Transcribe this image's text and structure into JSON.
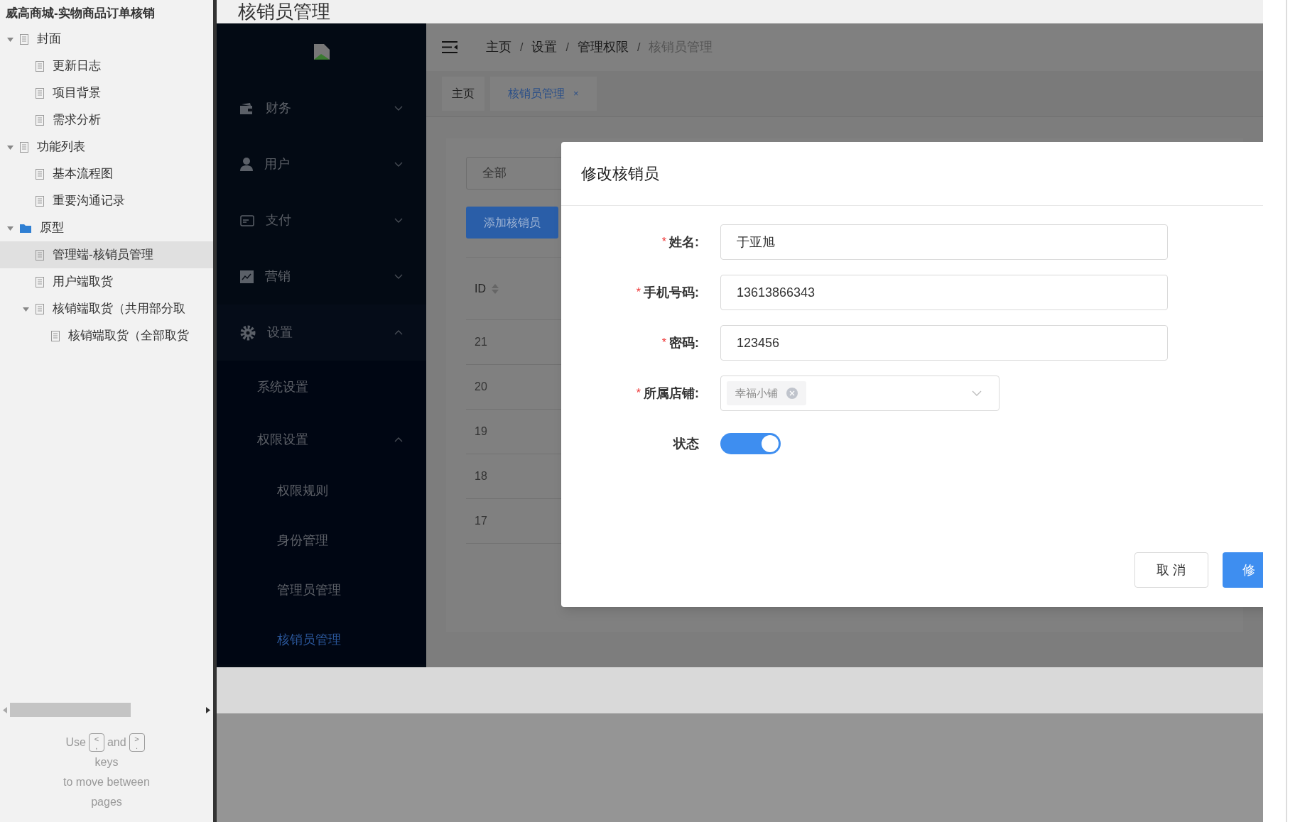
{
  "doc_panel": {
    "title": "威高商城-实物商品订单核销",
    "tree": [
      {
        "label": "封面",
        "kind": "page",
        "expanded": true,
        "selected": false,
        "children": [
          {
            "label": "更新日志",
            "kind": "page",
            "selected": false
          },
          {
            "label": "项目背景",
            "kind": "page",
            "selected": false
          },
          {
            "label": "需求分析",
            "kind": "page",
            "selected": false
          }
        ]
      },
      {
        "label": "功能列表",
        "kind": "page",
        "expanded": true,
        "selected": false,
        "children": [
          {
            "label": "基本流程图",
            "kind": "page",
            "selected": false
          },
          {
            "label": "重要沟通记录",
            "kind": "page",
            "selected": false
          }
        ]
      },
      {
        "label": "原型",
        "kind": "folder",
        "expanded": true,
        "selected": false,
        "children": [
          {
            "label": "管理端-核销员管理",
            "kind": "page",
            "selected": true
          },
          {
            "label": "用户端取货",
            "kind": "page",
            "selected": false
          },
          {
            "label": "核销端取货（共用部分取",
            "kind": "page",
            "expanded": true,
            "selected": false,
            "children": [
              {
                "label": "核销端取货（全部取货",
                "kind": "page",
                "selected": false
              }
            ]
          }
        ]
      }
    ],
    "hint": {
      "before": "Use",
      "key_prev": [
        "<",
        ","
      ],
      "middle": "and",
      "key_next": [
        ">",
        "."
      ],
      "lines": [
        "keys",
        "to move between",
        "pages"
      ]
    }
  },
  "page_title": "核销员管理",
  "app": {
    "menu": [
      {
        "label": "财务",
        "kind": "wallet",
        "expanded": false
      },
      {
        "label": "用户",
        "kind": "user",
        "expanded": false
      },
      {
        "label": "支付",
        "kind": "card",
        "expanded": false
      },
      {
        "label": "营销",
        "kind": "chart",
        "expanded": false
      },
      {
        "label": "设置",
        "kind": "gear",
        "expanded": true,
        "children": [
          {
            "label": "系统设置",
            "selected": false
          },
          {
            "label": "权限设置",
            "expanded": true,
            "children": [
              {
                "label": "权限规则",
                "selected": false
              },
              {
                "label": "身份管理",
                "selected": false
              },
              {
                "label": "管理员管理",
                "selected": false
              },
              {
                "label": "核销员管理",
                "selected": true
              }
            ]
          }
        ]
      }
    ],
    "breadcrumb": [
      "主页",
      "设置",
      "管理权限",
      "核销员管理"
    ],
    "breadcrumb_separator": "/",
    "tabs": [
      {
        "label": "主页",
        "selected": false,
        "closable": false
      },
      {
        "label": "核销员管理",
        "selected": true,
        "closable": true,
        "close": "×"
      }
    ],
    "filter": {
      "value": "全部"
    },
    "add_button": "添加核销员",
    "table": {
      "columns": [
        "ID"
      ],
      "rows": [
        "21",
        "20",
        "19",
        "18",
        "17"
      ]
    }
  },
  "dialog": {
    "title": "修改核销员",
    "fields": [
      {
        "label": "姓名:",
        "required": true,
        "kind": "text",
        "value": "于亚旭"
      },
      {
        "label": "手机号码:",
        "required": true,
        "kind": "text",
        "value": "13613866343"
      },
      {
        "label": "密码:",
        "required": true,
        "kind": "text",
        "value": "123456"
      },
      {
        "label": "所属店铺:",
        "required": true,
        "kind": "select",
        "tags": [
          "幸福小铺"
        ]
      },
      {
        "label": "状态",
        "required": false,
        "kind": "switch",
        "on": true
      }
    ],
    "required_mark": "*",
    "buttons": [
      {
        "label": "取 消",
        "kind": "default"
      },
      {
        "label": "修",
        "kind": "primary"
      }
    ]
  }
}
